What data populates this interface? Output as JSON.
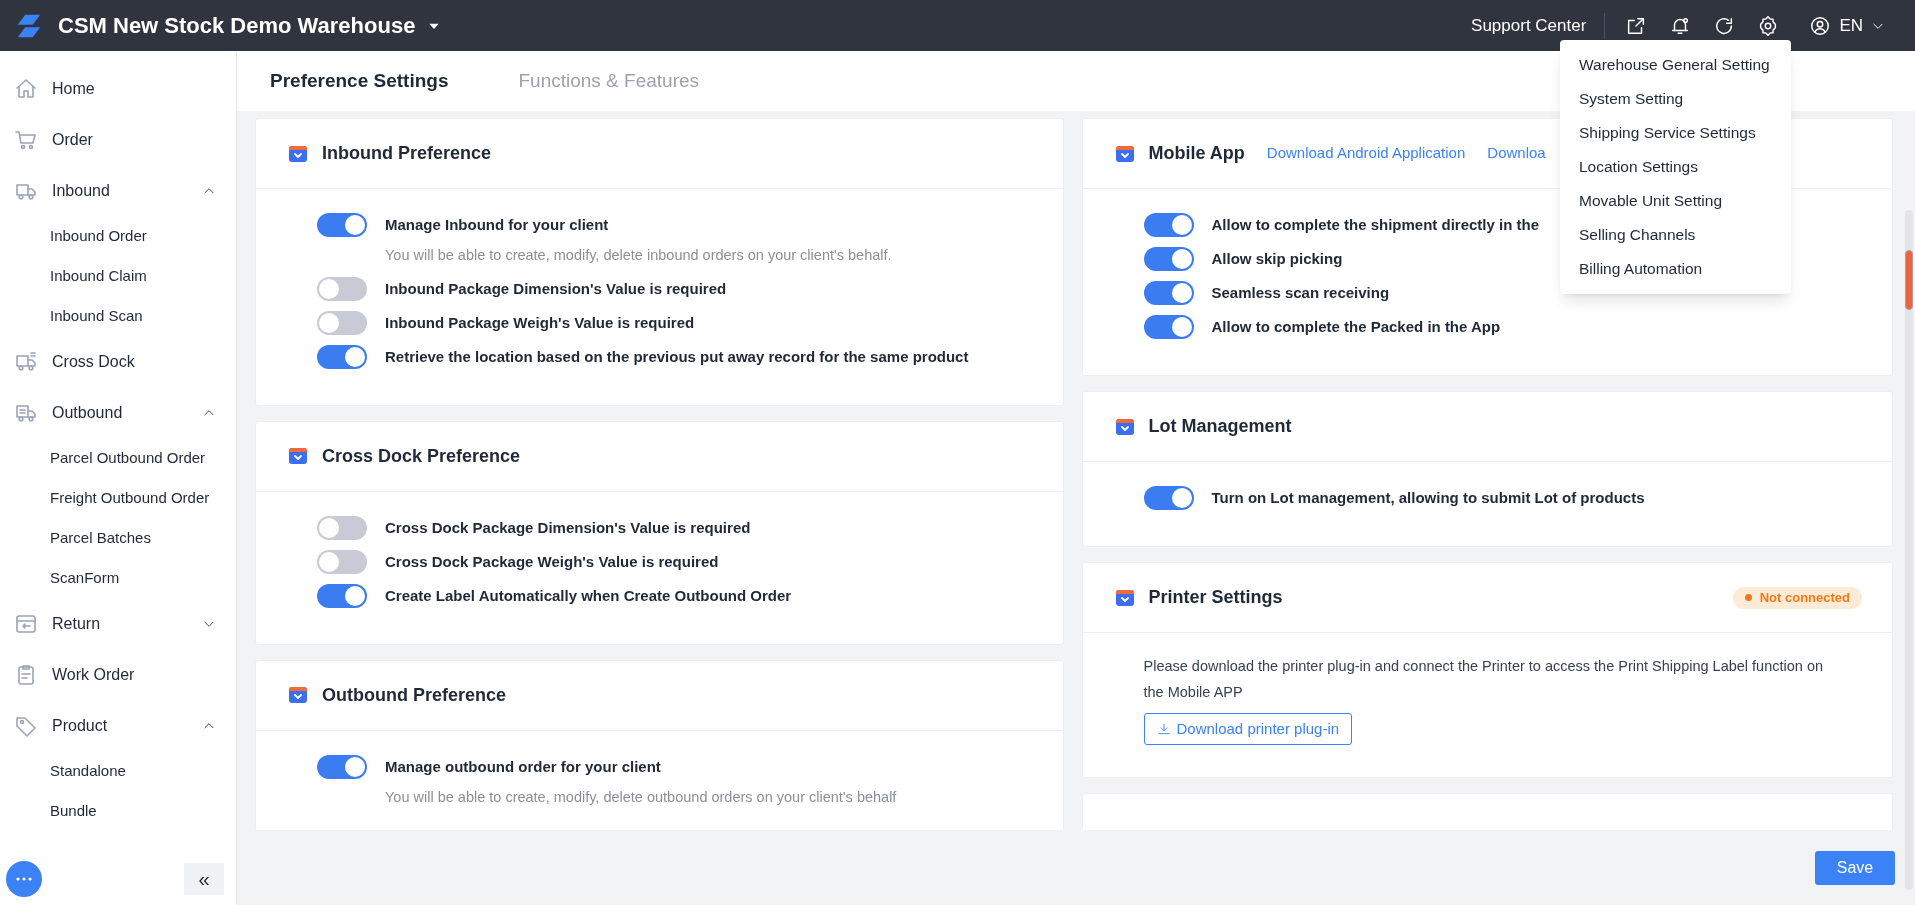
{
  "topbar": {
    "warehouse": "CSM New Stock Demo Warehouse",
    "support": "Support Center",
    "language": "EN"
  },
  "sidebar": {
    "items": [
      {
        "label": "Home"
      },
      {
        "label": "Order"
      },
      {
        "label": "Inbound",
        "expanded": true,
        "children": [
          {
            "label": "Inbound Order"
          },
          {
            "label": "Inbound Claim"
          },
          {
            "label": "Inbound Scan"
          }
        ]
      },
      {
        "label": "Cross Dock"
      },
      {
        "label": "Outbound",
        "expanded": true,
        "children": [
          {
            "label": "Parcel Outbound Order"
          },
          {
            "label": "Freight Outbound Order"
          },
          {
            "label": "Parcel Batches"
          },
          {
            "label": "ScanForm"
          }
        ]
      },
      {
        "label": "Return",
        "expanded": false
      },
      {
        "label": "Work Order"
      },
      {
        "label": "Product",
        "expanded": true,
        "children": [
          {
            "label": "Standalone"
          },
          {
            "label": "Bundle"
          }
        ]
      }
    ],
    "collapse": "«"
  },
  "tabs": [
    {
      "label": "Preference Settings",
      "selected": true
    },
    {
      "label": "Functions & Features",
      "selected": false
    }
  ],
  "left_cards": [
    {
      "title": "Inbound Preference",
      "settings": [
        {
          "label": "Manage Inbound for your client",
          "on": true,
          "description": "You will be able to create, modify, delete inbound orders on your client's behalf."
        },
        {
          "label": "Inbound Package Dimension's Value is required",
          "on": false
        },
        {
          "label": "Inbound Package Weigh's Value is required",
          "on": false
        },
        {
          "label": "Retrieve the location based on the previous put away record for the same product",
          "on": true
        }
      ]
    },
    {
      "title": "Cross Dock Preference",
      "settings": [
        {
          "label": "Cross Dock Package Dimension's Value is required",
          "on": false
        },
        {
          "label": "Cross Dock Package Weigh's Value is required",
          "on": false
        },
        {
          "label": "Create Label Automatically when Create Outbound Order",
          "on": true
        }
      ]
    },
    {
      "title": "Outbound Preference",
      "settings": [
        {
          "label": "Manage outbound order for your client",
          "on": true,
          "description": "You will be able to create, modify, delete outbound orders on your client's behalf"
        }
      ]
    }
  ],
  "right_cards": [
    {
      "title": "Mobile App",
      "links": [
        "Download Android Application",
        "Downloa"
      ],
      "settings": [
        {
          "label": "Allow to complete the shipment directly in the",
          "on": true
        },
        {
          "label": "Allow skip picking",
          "on": true
        },
        {
          "label": "Seamless scan receiving",
          "on": true
        },
        {
          "label": "Allow to complete the Packed in the App",
          "on": true
        }
      ]
    },
    {
      "title": "Lot Management",
      "settings": [
        {
          "label": "Turn on Lot management, allowing to submit Lot of products",
          "on": true
        }
      ]
    },
    {
      "title": "Printer Settings",
      "badge": "Not connected",
      "text": "Please download the printer plug-in and connect the Printer to access the Print Shipping Label function on the Mobile APP",
      "button": "Download printer plug-in"
    }
  ],
  "settings_menu": {
    "items": [
      "Warehouse General Setting",
      "System Setting",
      "Shipping Service Settings",
      "Location Settings",
      "Movable Unit Setting",
      "Selling Channels",
      "Billing Automation"
    ]
  },
  "save_button": "Save"
}
